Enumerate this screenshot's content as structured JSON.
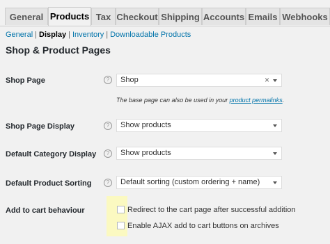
{
  "tabs": [
    "General",
    "Products",
    "Tax",
    "Checkout",
    "Shipping",
    "Accounts",
    "Emails",
    "Webhooks"
  ],
  "subnav": {
    "general": "General",
    "display": "Display",
    "inventory": "Inventory",
    "downloadable": "Downloadable Products",
    "separator": "|"
  },
  "section_title": "Shop & Product Pages",
  "fields": {
    "shop_page": {
      "label": "Shop Page",
      "value": "Shop",
      "clear": "×",
      "desc_prefix": "The base page can also be used in your ",
      "desc_link": "product permalinks",
      "desc_suffix": "."
    },
    "shop_page_display": {
      "label": "Shop Page Display",
      "value": "Show products"
    },
    "default_category_display": {
      "label": "Default Category Display",
      "value": "Show products"
    },
    "default_product_sorting": {
      "label": "Default Product Sorting",
      "value": "Default sorting (custom ordering + name)"
    },
    "add_to_cart": {
      "label": "Add to cart behaviour",
      "option1": "Redirect to the cart page after successful addition",
      "option2": "Enable AJAX add to cart buttons on archives"
    }
  },
  "help_icon": "?",
  "colors": {
    "link": "#0073aa",
    "highlight": "#fbf9c1"
  }
}
